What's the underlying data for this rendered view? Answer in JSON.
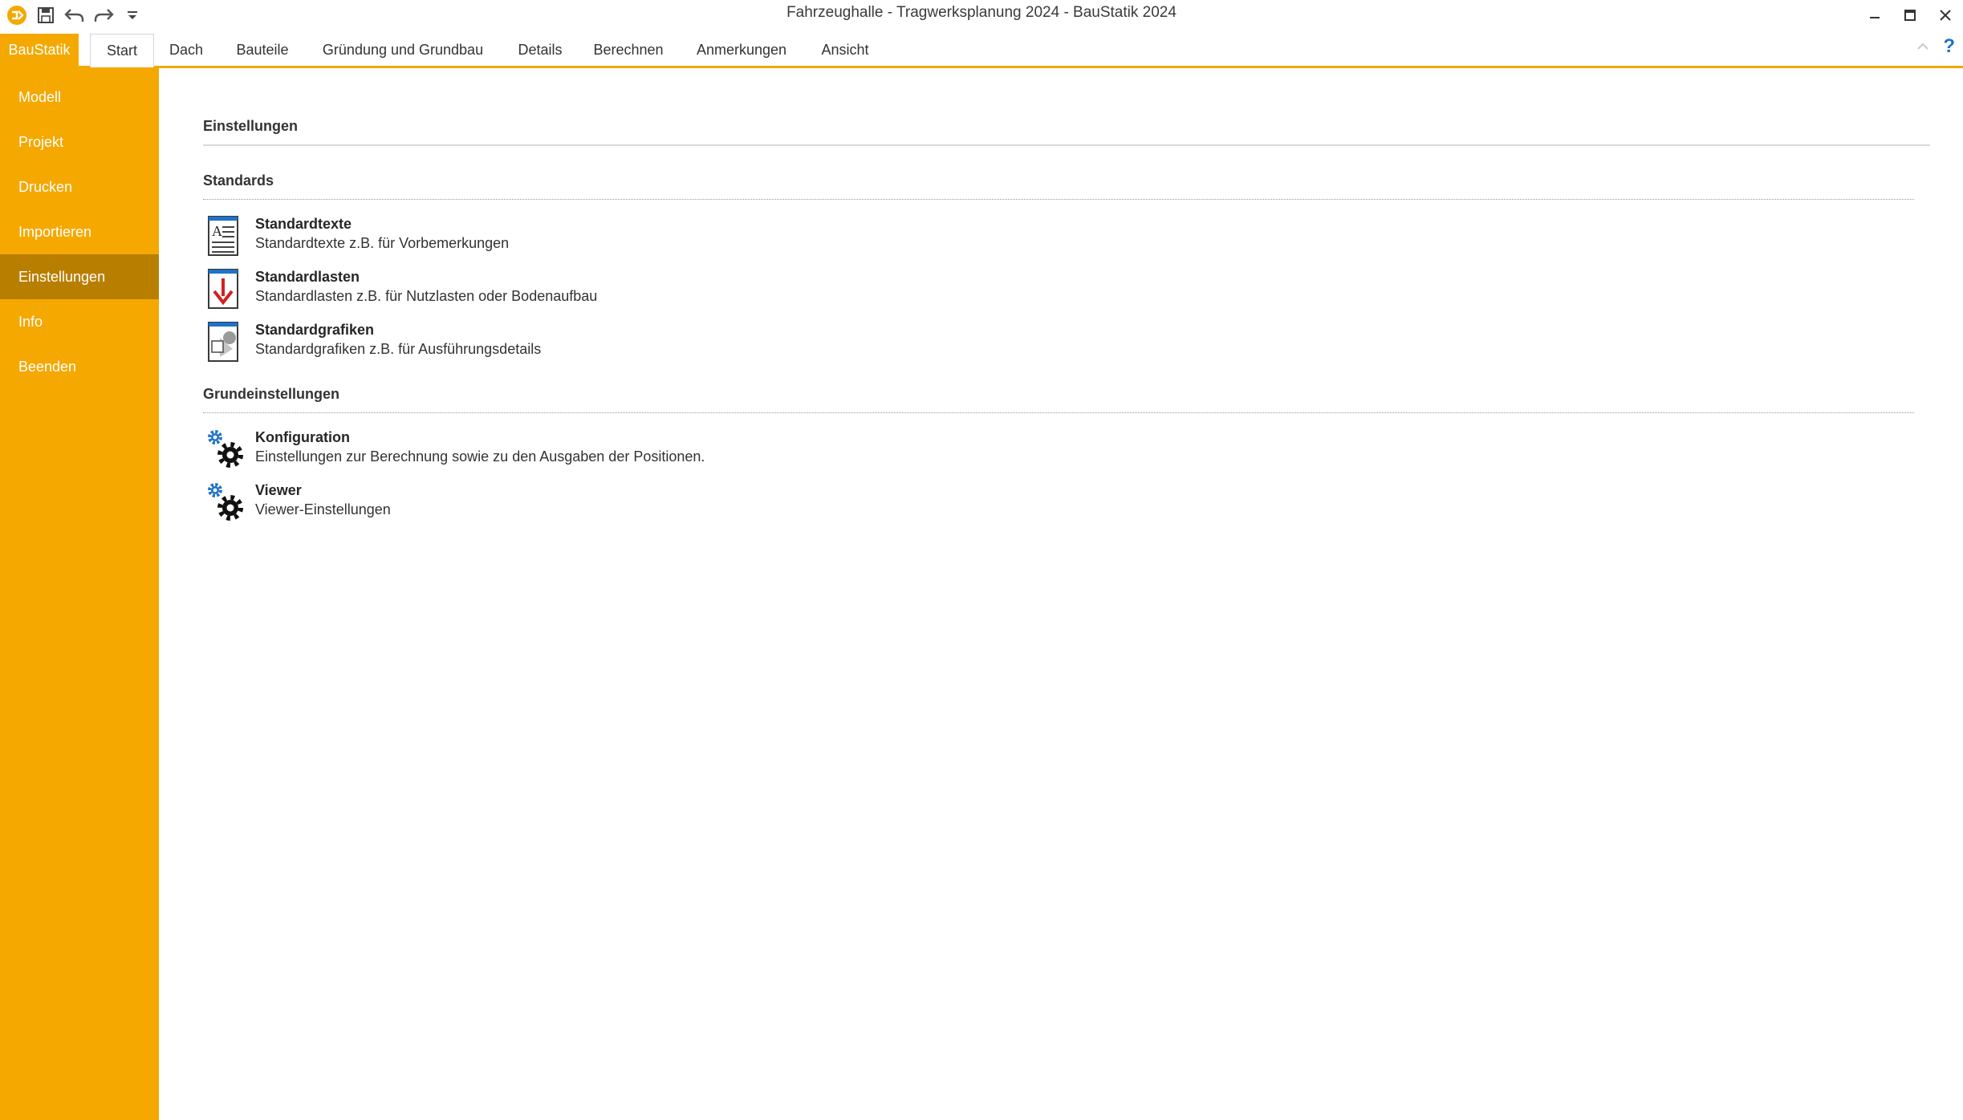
{
  "window": {
    "title": "Fahrzeughalle - Tragwerksplanung 2024 - BauStatik 2024"
  },
  "quick_access": {
    "icons": [
      "app-logo-icon",
      "save-icon",
      "undo-icon",
      "redo-icon",
      "customize-dropdown-icon"
    ]
  },
  "ribbon": {
    "app_button": "BauStatik",
    "tabs": [
      {
        "label": "Start"
      },
      {
        "label": "Dach"
      },
      {
        "label": "Bauteile"
      },
      {
        "label": "Gründung und Grundbau"
      },
      {
        "label": "Details"
      },
      {
        "label": "Berechnen"
      },
      {
        "label": "Anmerkungen"
      },
      {
        "label": "Ansicht"
      }
    ],
    "active_tab": "Start",
    "help_glyph": "?"
  },
  "sidebar": {
    "items": [
      {
        "label": "Modell"
      },
      {
        "label": "Projekt"
      },
      {
        "label": "Drucken"
      },
      {
        "label": "Importieren"
      },
      {
        "label": "Einstellungen"
      },
      {
        "label": "Info"
      },
      {
        "label": "Beenden"
      }
    ],
    "active": "Einstellungen"
  },
  "main": {
    "title": "Einstellungen",
    "sections": [
      {
        "title": "Standards",
        "items": [
          {
            "title": "Standardtexte",
            "desc": "Standardtexte z.B. für Vorbemerkungen",
            "icon": "text-document-icon"
          },
          {
            "title": "Standardlasten",
            "desc": "Standardlasten z.B. für Nutzlasten oder Bodenaufbau",
            "icon": "load-arrow-document-icon"
          },
          {
            "title": "Standardgrafiken",
            "desc": "Standardgrafiken z.B. für Ausführungsdetails",
            "icon": "graphic-document-icon"
          }
        ]
      },
      {
        "title": "Grundeinstellungen",
        "items": [
          {
            "title": "Konfiguration",
            "desc": "Einstellungen zur Berechnung sowie zu den Ausgaben der Positionen.",
            "icon": "gears-icon"
          },
          {
            "title": "Viewer",
            "desc": "Viewer-Einstellungen",
            "icon": "gears-icon"
          }
        ]
      }
    ]
  },
  "colors": {
    "accent": "#f5a800",
    "sidebar_active": "#b87e00",
    "icon_blue": "#1e72c8",
    "icon_red": "#d32020"
  }
}
